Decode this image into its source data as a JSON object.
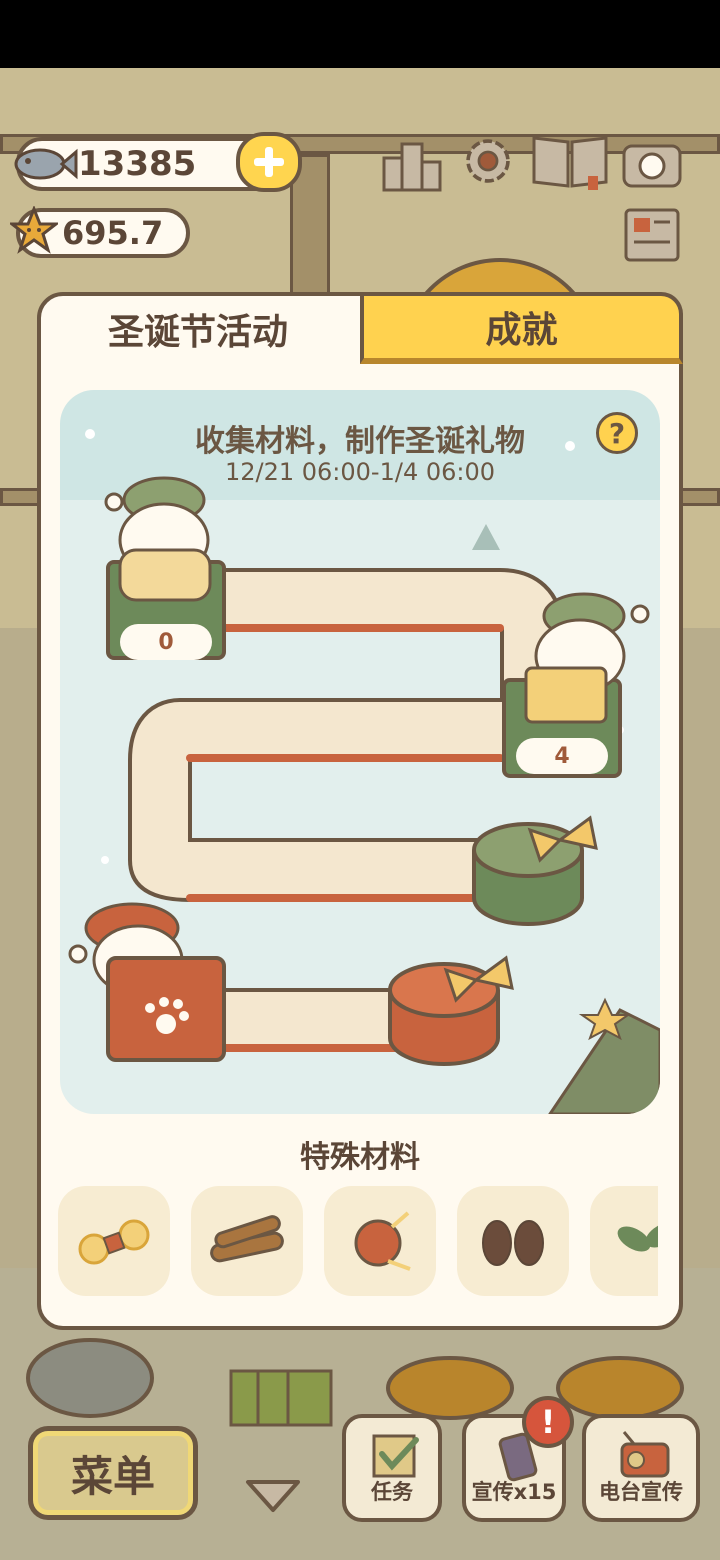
{
  "hud": {
    "fish_count": "13385",
    "star_count": "695.7",
    "icons": [
      "fish-icon",
      "star-icon",
      "plus-icon",
      "ranking-icon",
      "settings-gear-icon",
      "guidebook-icon",
      "camera-icon",
      "newspaper-icon"
    ]
  },
  "panel": {
    "tabs": [
      {
        "label": "圣诞节活动",
        "active": true
      },
      {
        "label": "成就",
        "active": false
      }
    ],
    "event": {
      "title": "收集材料，制作圣诞礼物",
      "date_range": "12/21 06:00-1/4 06:00",
      "help_label": "?",
      "stations": [
        {
          "name": "straw-station",
          "count": "0"
        },
        {
          "name": "box-station",
          "count": "4"
        }
      ]
    },
    "materials": {
      "title": "特殊材料",
      "items": [
        {
          "icon": "straw-bundle-icon"
        },
        {
          "icon": "wood-log-icon"
        },
        {
          "icon": "yarn-ball-icon"
        },
        {
          "icon": "mittens-icon"
        },
        {
          "icon": "leaf-icon"
        }
      ]
    }
  },
  "bottom_bar": {
    "menu_label": "菜单",
    "task_label": "任务",
    "promo_label": "宣传x15",
    "radio_label": "电台宣传",
    "alert": "!"
  },
  "colors": {
    "outline": "#6b5743",
    "accent_yellow": "#ffd24f",
    "panel_bg": "#fffaf0",
    "green": "#6d8a5a",
    "orange": "#c8633e"
  }
}
